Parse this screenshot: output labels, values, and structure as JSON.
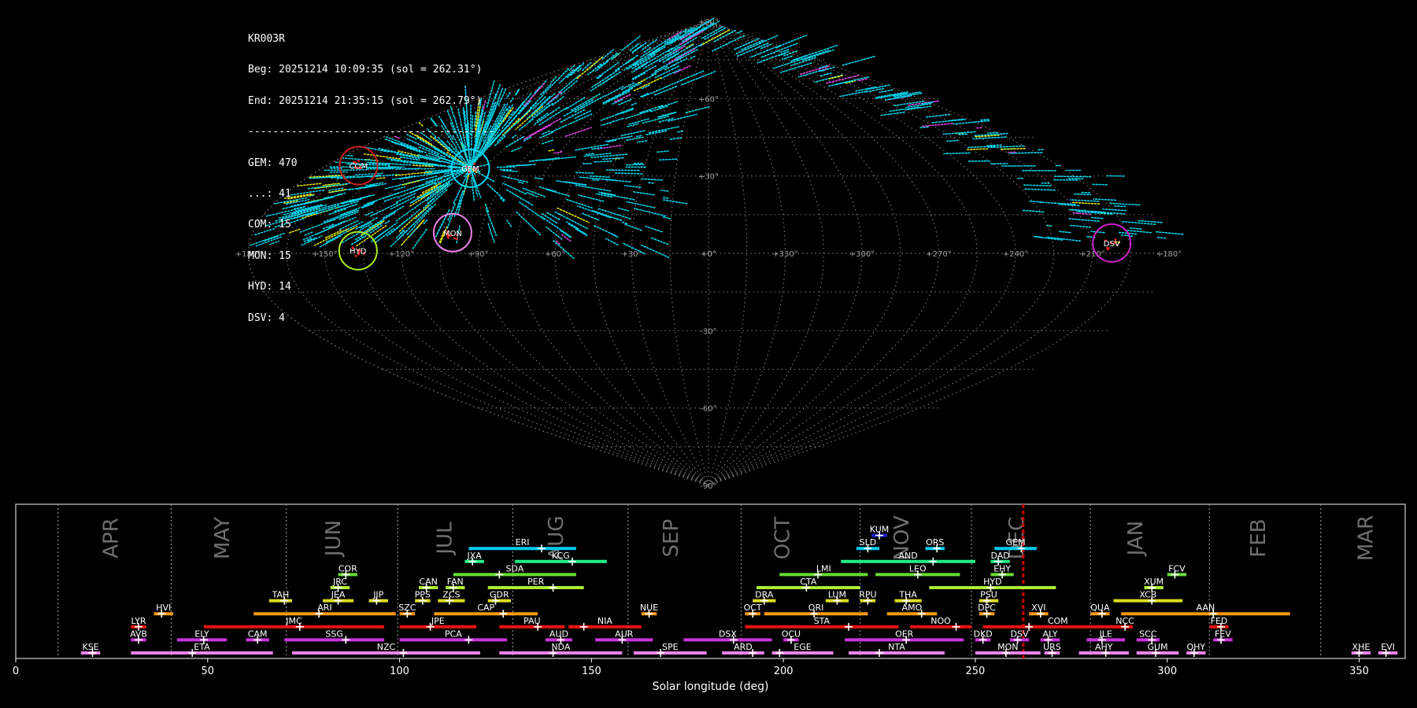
{
  "header": {
    "station": "KR003R",
    "begin": "Beg: 20251214 10:09:35 (sol = 262.31°)",
    "end": "End: 20251214 21:35:15 (sol = 262.79°)",
    "separator": "----------------------------------------",
    "counts": [
      "GEM: 470",
      "...: 41",
      "COM: 15",
      "MON: 15",
      "HYD: 14",
      "DSV: 4"
    ]
  },
  "sky_map": {
    "projection": "sinusoidal",
    "lat_labels": [
      "+90°",
      "+60°",
      "+30°",
      "+0°",
      "-30°",
      "-60°",
      "-90°"
    ],
    "lon_labels": [
      "+180°",
      "+150°",
      "+120°",
      "+90°",
      "+60°",
      "+30°",
      "+0°",
      "+330°",
      "+300°",
      "+270°",
      "+240°",
      "+210°",
      "+180°"
    ],
    "radiants": [
      {
        "code": "COM",
        "lon": 165,
        "lat": 34,
        "color": "#cc2222"
      },
      {
        "code": "GEM",
        "lon": 111,
        "lat": 33,
        "color": "#00d7ee"
      },
      {
        "code": "HYD",
        "lon": 137,
        "lat": 1,
        "color": "#aaee22"
      },
      {
        "code": "MON",
        "lon": 101,
        "lat": 8,
        "color": "#ee82ee"
      },
      {
        "code": "DSV",
        "lon": 202,
        "lat": 4,
        "color": "#cc22cc"
      }
    ],
    "colors": {
      "grid": "#9a9a9a",
      "trails": "#00d7ee",
      "sporadic": "#e5e500"
    }
  },
  "chart_data": {
    "type": "timeline",
    "xlabel": "Solar longitude (deg)",
    "xlim": [
      0,
      362
    ],
    "xticks": [
      0,
      50,
      100,
      150,
      200,
      250,
      300,
      350
    ],
    "current_sol": 262.5,
    "month_dividers": [
      11,
      40.5,
      70.5,
      99.5,
      129.5,
      159.5,
      189,
      220,
      249,
      280,
      311,
      340
    ],
    "months": [
      {
        "label": "APR",
        "sol": 25
      },
      {
        "label": "MAY",
        "sol": 54
      },
      {
        "label": "JUN",
        "sol": 83
      },
      {
        "label": "JUL",
        "sol": 112
      },
      {
        "label": "AUG",
        "sol": 141
      },
      {
        "label": "SEP",
        "sol": 171
      },
      {
        "label": "OCT",
        "sol": 200
      },
      {
        "label": "NOV",
        "sol": 231
      },
      {
        "label": "DEC",
        "sol": 261
      },
      {
        "label": "JAN",
        "sol": 292
      },
      {
        "label": "FEB",
        "sol": 324
      },
      {
        "label": "MAR",
        "sol": 352
      }
    ],
    "showers": [
      {
        "code": "KUM",
        "start": 223,
        "end": 227,
        "peak": 225,
        "row": 10,
        "color": "#1c1cd8"
      },
      {
        "code": "ERI",
        "start": 118,
        "end": 146,
        "peak": 137,
        "row": 9,
        "color": "#00ccee"
      },
      {
        "code": "SLD",
        "start": 219,
        "end": 225,
        "peak": 222,
        "row": 9,
        "color": "#00ccee"
      },
      {
        "code": "ORS",
        "start": 237,
        "end": 242,
        "peak": 240,
        "row": 9,
        "color": "#00ccee"
      },
      {
        "code": "GEM",
        "start": 255,
        "end": 266,
        "peak": 262,
        "row": 9,
        "color": "#00ccee"
      },
      {
        "code": "JXA",
        "start": 117,
        "end": 122,
        "peak": 119,
        "row": 8,
        "color": "#22ee88"
      },
      {
        "code": "KCG",
        "start": 130,
        "end": 154,
        "peak": 145,
        "row": 8,
        "color": "#22ee88"
      },
      {
        "code": "AND",
        "start": 215,
        "end": 250,
        "peak": 239,
        "row": 8,
        "color": "#22ee88"
      },
      {
        "code": "DAD",
        "start": 254,
        "end": 259,
        "peak": 256,
        "row": 8,
        "color": "#22ee88"
      },
      {
        "code": "COR",
        "start": 84,
        "end": 89,
        "peak": 86,
        "row": 7,
        "color": "#66dd33"
      },
      {
        "code": "SDA",
        "start": 114,
        "end": 146,
        "peak": 126,
        "row": 7,
        "color": "#66dd33"
      },
      {
        "code": "LMI",
        "start": 199,
        "end": 222,
        "peak": 209,
        "row": 7,
        "color": "#66dd33"
      },
      {
        "code": "LEO",
        "start": 224,
        "end": 246,
        "peak": 235,
        "row": 7,
        "color": "#66dd33"
      },
      {
        "code": "EHY",
        "start": 254,
        "end": 260,
        "peak": 257,
        "row": 7,
        "color": "#66dd33"
      },
      {
        "code": "FCV",
        "start": 300,
        "end": 305,
        "peak": 302,
        "row": 7,
        "color": "#66dd33"
      },
      {
        "code": "JRC",
        "start": 82,
        "end": 87,
        "peak": 84,
        "row": 6,
        "color": "#aaee33"
      },
      {
        "code": "CAN",
        "start": 105,
        "end": 110,
        "peak": 107,
        "row": 6,
        "color": "#aaee33"
      },
      {
        "code": "FAN",
        "start": 112,
        "end": 117,
        "peak": 114,
        "row": 6,
        "color": "#aaee33"
      },
      {
        "code": "PER",
        "start": 123,
        "end": 148,
        "peak": 140,
        "row": 6,
        "color": "#aaee33"
      },
      {
        "code": "CTA",
        "start": 193,
        "end": 220,
        "peak": 206,
        "row": 6,
        "color": "#aaee33"
      },
      {
        "code": "HYD",
        "start": 238,
        "end": 271,
        "peak": 254,
        "row": 6,
        "color": "#aaee33"
      },
      {
        "code": "XUM",
        "start": 294,
        "end": 299,
        "peak": 296,
        "row": 6,
        "color": "#aaee33"
      },
      {
        "code": "TAH",
        "start": 66,
        "end": 72,
        "peak": 70,
        "row": 5,
        "color": "#dddd22"
      },
      {
        "code": "JEA",
        "start": 80,
        "end": 88,
        "peak": 84,
        "row": 5,
        "color": "#dddd22"
      },
      {
        "code": "JIP",
        "start": 92,
        "end": 97,
        "peak": 94,
        "row": 5,
        "color": "#dddd22"
      },
      {
        "code": "PPS",
        "start": 104,
        "end": 108,
        "peak": 106,
        "row": 5,
        "color": "#dddd22"
      },
      {
        "code": "ZCS",
        "start": 110,
        "end": 117,
        "peak": 113,
        "row": 5,
        "color": "#dddd22"
      },
      {
        "code": "GDR",
        "start": 123,
        "end": 129,
        "peak": 125,
        "row": 5,
        "color": "#dddd22"
      },
      {
        "code": "DRA",
        "start": 192,
        "end": 198,
        "peak": 195,
        "row": 5,
        "color": "#dddd22"
      },
      {
        "code": "LUM",
        "start": 211,
        "end": 217,
        "peak": 214,
        "row": 5,
        "color": "#dddd22"
      },
      {
        "code": "RPU",
        "start": 220,
        "end": 224,
        "peak": 222,
        "row": 5,
        "color": "#dddd22"
      },
      {
        "code": "THA",
        "start": 229,
        "end": 236,
        "peak": 232,
        "row": 5,
        "color": "#dddd22"
      },
      {
        "code": "PSU",
        "start": 251,
        "end": 256,
        "peak": 253,
        "row": 5,
        "color": "#dddd22"
      },
      {
        "code": "XCB",
        "start": 286,
        "end": 304,
        "peak": 296,
        "row": 5,
        "color": "#dddd22"
      },
      {
        "code": "HVI",
        "start": 36,
        "end": 41,
        "peak": 38,
        "row": 4,
        "color": "#ff9911"
      },
      {
        "code": "ARI",
        "start": 62,
        "end": 99,
        "peak": 79,
        "row": 4,
        "color": "#ff9911"
      },
      {
        "code": "SZC",
        "start": 100,
        "end": 104,
        "peak": 102,
        "row": 4,
        "color": "#ff9911"
      },
      {
        "code": "CAP",
        "start": 109,
        "end": 136,
        "peak": 127,
        "row": 4,
        "color": "#ff9911"
      },
      {
        "code": "NUE",
        "start": 163,
        "end": 167,
        "peak": 165,
        "row": 4,
        "color": "#ff9911"
      },
      {
        "code": "OCT",
        "start": 190,
        "end": 194,
        "peak": 192,
        "row": 4,
        "color": "#ff9911"
      },
      {
        "code": "ORI",
        "start": 195,
        "end": 222,
        "peak": 208,
        "row": 4,
        "color": "#ff9911"
      },
      {
        "code": "AMO",
        "start": 227,
        "end": 240,
        "peak": 236,
        "row": 4,
        "color": "#ff9911"
      },
      {
        "code": "DPC",
        "start": 251,
        "end": 255,
        "peak": 253,
        "row": 4,
        "color": "#ff9911"
      },
      {
        "code": "XVI",
        "start": 264,
        "end": 269,
        "peak": 267,
        "row": 4,
        "color": "#ff9911"
      },
      {
        "code": "QUA",
        "start": 280,
        "end": 285,
        "peak": 283,
        "row": 4,
        "color": "#ff9911"
      },
      {
        "code": "AAN",
        "start": 288,
        "end": 332,
        "peak": 312,
        "row": 4,
        "color": "#ff9911"
      },
      {
        "code": "LYR",
        "start": 30,
        "end": 34,
        "peak": 32,
        "row": 3,
        "color": "#ee1111"
      },
      {
        "code": "JMC",
        "start": 49,
        "end": 96,
        "peak": 74,
        "row": 3,
        "color": "#ee1111"
      },
      {
        "code": "JPE",
        "start": 100,
        "end": 120,
        "peak": 108,
        "row": 3,
        "color": "#ee1111"
      },
      {
        "code": "PAU",
        "start": 126,
        "end": 143,
        "peak": 136,
        "row": 3,
        "color": "#ee1111"
      },
      {
        "code": "NIA",
        "start": 144,
        "end": 163,
        "peak": 148,
        "row": 3,
        "color": "#ee1111"
      },
      {
        "code": "STA",
        "start": 190,
        "end": 230,
        "peak": 217,
        "row": 3,
        "color": "#ee1111"
      },
      {
        "code": "NOO",
        "start": 233,
        "end": 249,
        "peak": 245,
        "row": 3,
        "color": "#ee1111"
      },
      {
        "code": "COM",
        "start": 252,
        "end": 291,
        "peak": 264,
        "row": 3,
        "color": "#ee1111"
      },
      {
        "code": "NCC",
        "start": 287,
        "end": 291,
        "peak": 289,
        "row": 3,
        "color": "#ee1111"
      },
      {
        "code": "FED",
        "start": 311,
        "end": 316,
        "peak": 314,
        "row": 3,
        "color": "#ee1111"
      },
      {
        "code": "AVB",
        "start": 30,
        "end": 34,
        "peak": 32,
        "row": 2,
        "color": "#cc33dd"
      },
      {
        "code": "ELY",
        "start": 42,
        "end": 55,
        "peak": 49,
        "row": 2,
        "color": "#cc33dd"
      },
      {
        "code": "CAM",
        "start": 60,
        "end": 66,
        "peak": 63,
        "row": 2,
        "color": "#cc33dd"
      },
      {
        "code": "SSG",
        "start": 70,
        "end": 96,
        "peak": 86,
        "row": 2,
        "color": "#cc33dd"
      },
      {
        "code": "PCA",
        "start": 100,
        "end": 128,
        "peak": 118,
        "row": 2,
        "color": "#cc33dd"
      },
      {
        "code": "AUD",
        "start": 138,
        "end": 145,
        "peak": 142,
        "row": 2,
        "color": "#cc33dd"
      },
      {
        "code": "AUR",
        "start": 151,
        "end": 166,
        "peak": 158,
        "row": 2,
        "color": "#cc33dd"
      },
      {
        "code": "DSX",
        "start": 174,
        "end": 197,
        "peak": 187,
        "row": 2,
        "color": "#cc33dd"
      },
      {
        "code": "OCU",
        "start": 200,
        "end": 204,
        "peak": 202,
        "row": 2,
        "color": "#cc33dd"
      },
      {
        "code": "OER",
        "start": 216,
        "end": 247,
        "peak": 232,
        "row": 2,
        "color": "#cc33dd"
      },
      {
        "code": "DKD",
        "start": 250,
        "end": 254,
        "peak": 252,
        "row": 2,
        "color": "#cc33dd"
      },
      {
        "code": "DSV",
        "start": 259,
        "end": 264,
        "peak": 261,
        "row": 2,
        "color": "#cc33dd"
      },
      {
        "code": "ALY",
        "start": 267,
        "end": 272,
        "peak": 269,
        "row": 2,
        "color": "#cc33dd"
      },
      {
        "code": "JLE",
        "start": 279,
        "end": 289,
        "peak": 283,
        "row": 2,
        "color": "#cc33dd"
      },
      {
        "code": "SCC",
        "start": 292,
        "end": 298,
        "peak": 296,
        "row": 2,
        "color": "#cc33dd"
      },
      {
        "code": "FEV",
        "start": 312,
        "end": 317,
        "peak": 314,
        "row": 2,
        "color": "#cc33dd"
      },
      {
        "code": "KSE",
        "start": 17,
        "end": 22,
        "peak": 20,
        "row": 1,
        "color": "#ee82ee"
      },
      {
        "code": "ETA",
        "start": 30,
        "end": 67,
        "peak": 46,
        "row": 1,
        "color": "#ee82ee"
      },
      {
        "code": "NZC",
        "start": 72,
        "end": 121,
        "peak": 101,
        "row": 1,
        "color": "#ee82ee"
      },
      {
        "code": "NDA",
        "start": 126,
        "end": 158,
        "peak": 140,
        "row": 1,
        "color": "#ee82ee"
      },
      {
        "code": "SPE",
        "start": 161,
        "end": 180,
        "peak": 168,
        "row": 1,
        "color": "#ee82ee"
      },
      {
        "code": "ARD",
        "start": 184,
        "end": 195,
        "peak": 192,
        "row": 1,
        "color": "#ee82ee"
      },
      {
        "code": "EGE",
        "start": 197,
        "end": 213,
        "peak": 199,
        "row": 1,
        "color": "#ee82ee"
      },
      {
        "code": "NTA",
        "start": 217,
        "end": 242,
        "peak": 225,
        "row": 1,
        "color": "#ee82ee"
      },
      {
        "code": "MON",
        "start": 250,
        "end": 267,
        "peak": 258,
        "row": 1,
        "color": "#ee82ee"
      },
      {
        "code": "URS",
        "start": 268,
        "end": 272,
        "peak": 270,
        "row": 1,
        "color": "#ee82ee"
      },
      {
        "code": "AHY",
        "start": 277,
        "end": 290,
        "peak": 284,
        "row": 1,
        "color": "#ee82ee"
      },
      {
        "code": "GUM",
        "start": 292,
        "end": 303,
        "peak": 297,
        "row": 1,
        "color": "#ee82ee"
      },
      {
        "code": "QHY",
        "start": 305,
        "end": 310,
        "peak": 307,
        "row": 1,
        "color": "#ee82ee"
      },
      {
        "code": "XHE",
        "start": 348,
        "end": 353,
        "peak": 350,
        "row": 1,
        "color": "#ee82ee"
      },
      {
        "code": "EVI",
        "start": 355,
        "end": 360,
        "peak": 357,
        "row": 1,
        "color": "#ee82ee"
      }
    ]
  }
}
